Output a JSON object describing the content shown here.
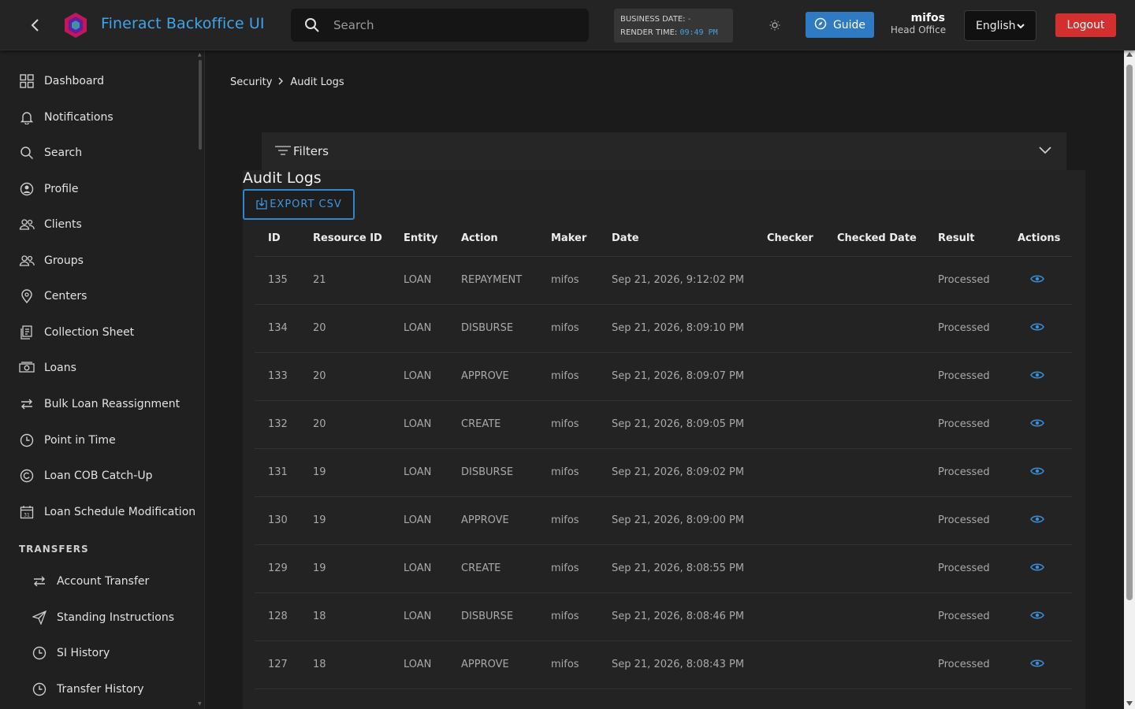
{
  "header": {
    "app_title": "Fineract Backoffice UI",
    "search_placeholder": "Search",
    "business_date_label": "BUSINESS DATE:",
    "business_date_value": "-",
    "render_time_label": "RENDER TIME:",
    "render_time_value": "09:49 PM",
    "guide_label": "Guide",
    "username": "mifos",
    "office": "Head Office",
    "language": "English",
    "logout_label": "Logout"
  },
  "sidebar": {
    "items": [
      {
        "label": "Dashboard",
        "icon": "dashboard-icon"
      },
      {
        "label": "Notifications",
        "icon": "bell-icon"
      },
      {
        "label": "Search",
        "icon": "search-icon"
      },
      {
        "label": "Profile",
        "icon": "profile-icon"
      },
      {
        "label": "Clients",
        "icon": "clients-icon"
      },
      {
        "label": "Groups",
        "icon": "groups-icon"
      },
      {
        "label": "Centers",
        "icon": "location-pin-icon"
      },
      {
        "label": "Collection Sheet",
        "icon": "collection-sheet-icon"
      },
      {
        "label": "Loans",
        "icon": "loans-icon"
      },
      {
        "label": "Bulk Loan Reassignment",
        "icon": "swap-icon"
      },
      {
        "label": "Point in Time",
        "icon": "clock-icon"
      },
      {
        "label": "Loan COB Catch-Up",
        "icon": "catch-up-icon"
      },
      {
        "label": "Loan Schedule Modification",
        "icon": "calendar-icon"
      }
    ],
    "transfers_title": "TRANSFERS",
    "transfer_items": [
      {
        "label": "Account Transfer",
        "icon": "swap-icon"
      },
      {
        "label": "Standing Instructions",
        "icon": "send-icon"
      },
      {
        "label": "SI History",
        "icon": "clock-icon"
      },
      {
        "label": "Transfer History",
        "icon": "clock-icon"
      }
    ]
  },
  "breadcrumb": {
    "parent": "Security",
    "current": "Audit Logs"
  },
  "filters": {
    "label": "Filters"
  },
  "audit": {
    "title": "Audit Logs",
    "export_label": "EXPORT CSV",
    "columns": [
      "ID",
      "Resource ID",
      "Entity",
      "Action",
      "Maker",
      "Date",
      "Checker",
      "Checked Date",
      "Result",
      "Actions"
    ],
    "rows": [
      {
        "id": "135",
        "resource_id": "21",
        "entity": "LOAN",
        "action": "REPAYMENT",
        "maker": "mifos",
        "date": "Sep 21, 2026, 9:12:02 PM",
        "checker": "",
        "checked_date": "",
        "result": "Processed"
      },
      {
        "id": "134",
        "resource_id": "20",
        "entity": "LOAN",
        "action": "DISBURSE",
        "maker": "mifos",
        "date": "Sep 21, 2026, 8:09:10 PM",
        "checker": "",
        "checked_date": "",
        "result": "Processed"
      },
      {
        "id": "133",
        "resource_id": "20",
        "entity": "LOAN",
        "action": "APPROVE",
        "maker": "mifos",
        "date": "Sep 21, 2026, 8:09:07 PM",
        "checker": "",
        "checked_date": "",
        "result": "Processed"
      },
      {
        "id": "132",
        "resource_id": "20",
        "entity": "LOAN",
        "action": "CREATE",
        "maker": "mifos",
        "date": "Sep 21, 2026, 8:09:05 PM",
        "checker": "",
        "checked_date": "",
        "result": "Processed"
      },
      {
        "id": "131",
        "resource_id": "19",
        "entity": "LOAN",
        "action": "DISBURSE",
        "maker": "mifos",
        "date": "Sep 21, 2026, 8:09:02 PM",
        "checker": "",
        "checked_date": "",
        "result": "Processed"
      },
      {
        "id": "130",
        "resource_id": "19",
        "entity": "LOAN",
        "action": "APPROVE",
        "maker": "mifos",
        "date": "Sep 21, 2026, 8:09:00 PM",
        "checker": "",
        "checked_date": "",
        "result": "Processed"
      },
      {
        "id": "129",
        "resource_id": "19",
        "entity": "LOAN",
        "action": "CREATE",
        "maker": "mifos",
        "date": "Sep 21, 2026, 8:08:55 PM",
        "checker": "",
        "checked_date": "",
        "result": "Processed"
      },
      {
        "id": "128",
        "resource_id": "18",
        "entity": "LOAN",
        "action": "DISBURSE",
        "maker": "mifos",
        "date": "Sep 21, 2026, 8:08:46 PM",
        "checker": "",
        "checked_date": "",
        "result": "Processed"
      },
      {
        "id": "127",
        "resource_id": "18",
        "entity": "LOAN",
        "action": "APPROVE",
        "maker": "mifos",
        "date": "Sep 21, 2026, 8:08:43 PM",
        "checker": "",
        "checked_date": "",
        "result": "Processed"
      }
    ]
  },
  "colors": {
    "accent": "#41a3e8",
    "guide_button": "#2e7bc4",
    "logout_button": "#d32f2f",
    "background": "#1b1b1b"
  }
}
